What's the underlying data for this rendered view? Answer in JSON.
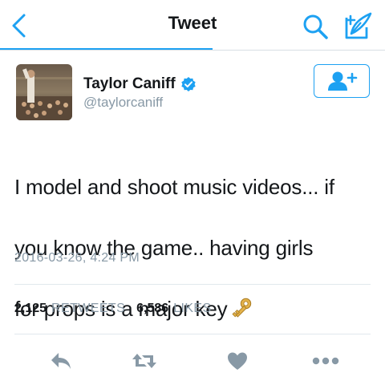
{
  "nav": {
    "title": "Tweet",
    "back_icon": "chevron-left-icon",
    "search_icon": "search-icon",
    "compose_icon": "compose-tweet-icon",
    "accent_color": "#1da1f2"
  },
  "author": {
    "display_name": "Taylor Caniff",
    "handle": "@taylorcaniff",
    "verified": true,
    "verified_icon": "verified-badge-icon",
    "avatar_icon": "avatar-photo",
    "follow_icon": "add-user-icon"
  },
  "tweet": {
    "lines": [
      "I model and shoot music videos... if",
      "you know the game.. having girls",
      "for  props is a major key"
    ],
    "emoji_icon": "key-emoji-icon",
    "timestamp": "2016-03-26, 4:24 PM"
  },
  "stats": {
    "retweets_count": "2,125",
    "retweets_label": "RETWEETS",
    "likes_count": "6,586",
    "likes_label": "LIKES"
  },
  "actions": {
    "reply_icon": "reply-icon",
    "retweet_icon": "retweet-icon",
    "like_icon": "heart-icon",
    "more_icon": "more-dots-icon",
    "icon_color": "#8899a6"
  }
}
